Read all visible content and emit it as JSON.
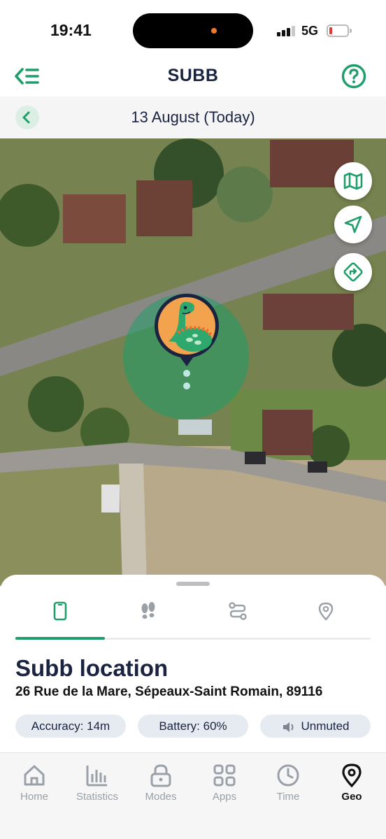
{
  "status_bar": {
    "time": "19:41",
    "network": "5G"
  },
  "header": {
    "title": "SUBB",
    "back_icon": "back-menu-icon",
    "help_icon": "help-icon"
  },
  "date_bar": {
    "label": "13 August (Today)"
  },
  "map": {
    "controls": [
      "map-icon",
      "navigate-arrow-icon",
      "directions-icon"
    ],
    "marker": "dinosaur-avatar",
    "accent": "#1e9e6a"
  },
  "sheet": {
    "tabs": [
      "phone-icon",
      "footsteps-icon",
      "route-icon",
      "pin-icon"
    ],
    "active_tab": 0,
    "title": "Subb location",
    "address": "26 Rue de la Mare, Sépeaux-Saint Romain, 89116",
    "chips": {
      "accuracy": "Accuracy: 14m",
      "battery": "Battery: 60%",
      "sound": "Unmuted"
    }
  },
  "nav": {
    "items": [
      {
        "label": "Home",
        "icon": "home-icon"
      },
      {
        "label": "Statistics",
        "icon": "statistics-icon"
      },
      {
        "label": "Modes",
        "icon": "lock-icon"
      },
      {
        "label": "Apps",
        "icon": "apps-grid-icon"
      },
      {
        "label": "Time",
        "icon": "clock-icon"
      },
      {
        "label": "Geo",
        "icon": "geo-pin-icon"
      }
    ],
    "active": "Geo"
  },
  "colors": {
    "primary": "#1e9e6a",
    "text": "#1a2340",
    "chip_bg": "#e6ebf2"
  }
}
